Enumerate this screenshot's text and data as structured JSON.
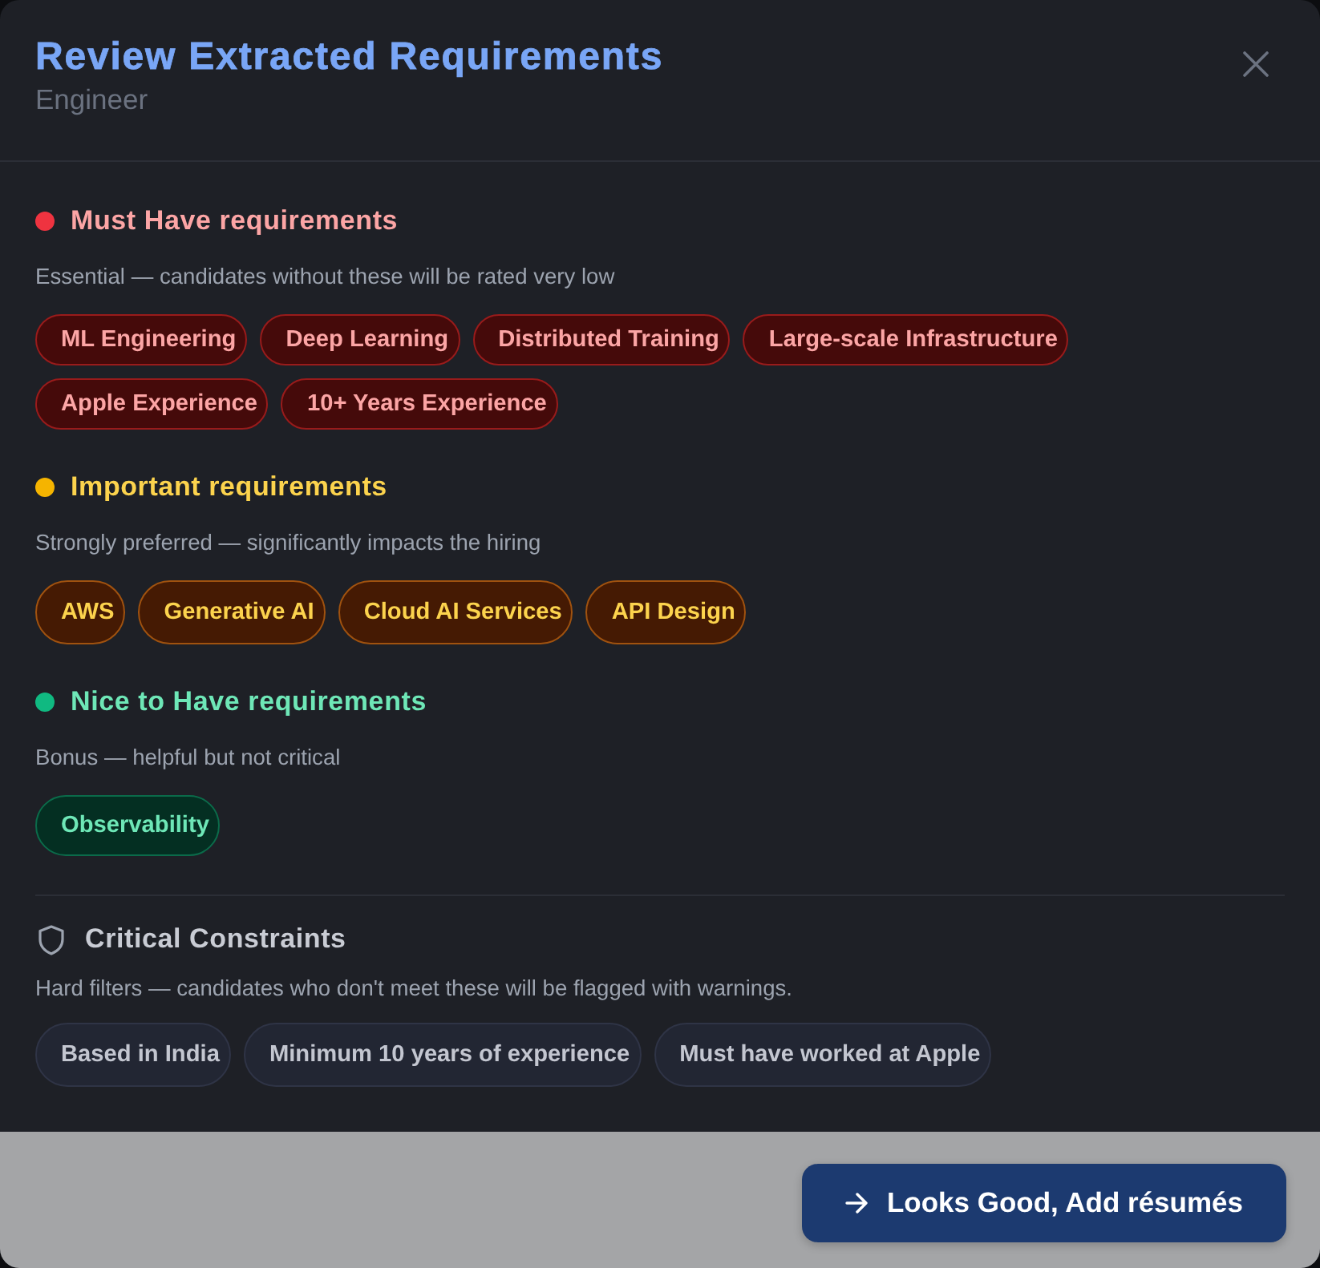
{
  "dialog": {
    "title": "Review Extracted Requirements",
    "subtitle": "Engineer"
  },
  "sections": [
    {
      "kind": "must",
      "color": "#ef3340",
      "title": "Must Have requirements",
      "description": "Essential — candidates without these will be rated very low",
      "tags": [
        "ML Engineering",
        "Deep Learning",
        "Distributed Training",
        "Large-scale Infrastructure",
        "Apple Experience",
        "10+ Years Experience"
      ]
    },
    {
      "kind": "important",
      "color": "#f5b400",
      "title": "Important requirements",
      "description": "Strongly preferred — significantly impacts the hiring",
      "tags": [
        "AWS",
        "Generative AI",
        "Cloud AI Services",
        "API Design"
      ]
    },
    {
      "kind": "nice",
      "color": "#10b981",
      "title": "Nice to Have requirements",
      "description": "Bonus — helpful but not critical",
      "tags": [
        "Observability"
      ]
    }
  ],
  "constraints": {
    "title": "Critical Constraints",
    "description": "Hard filters — candidates who don't meet these will be flagged with warnings.",
    "tags": [
      "Based in India",
      "Minimum 10 years of experience",
      "Must have worked at Apple"
    ]
  },
  "footer": {
    "button": "Looks Good, Add résumés"
  }
}
